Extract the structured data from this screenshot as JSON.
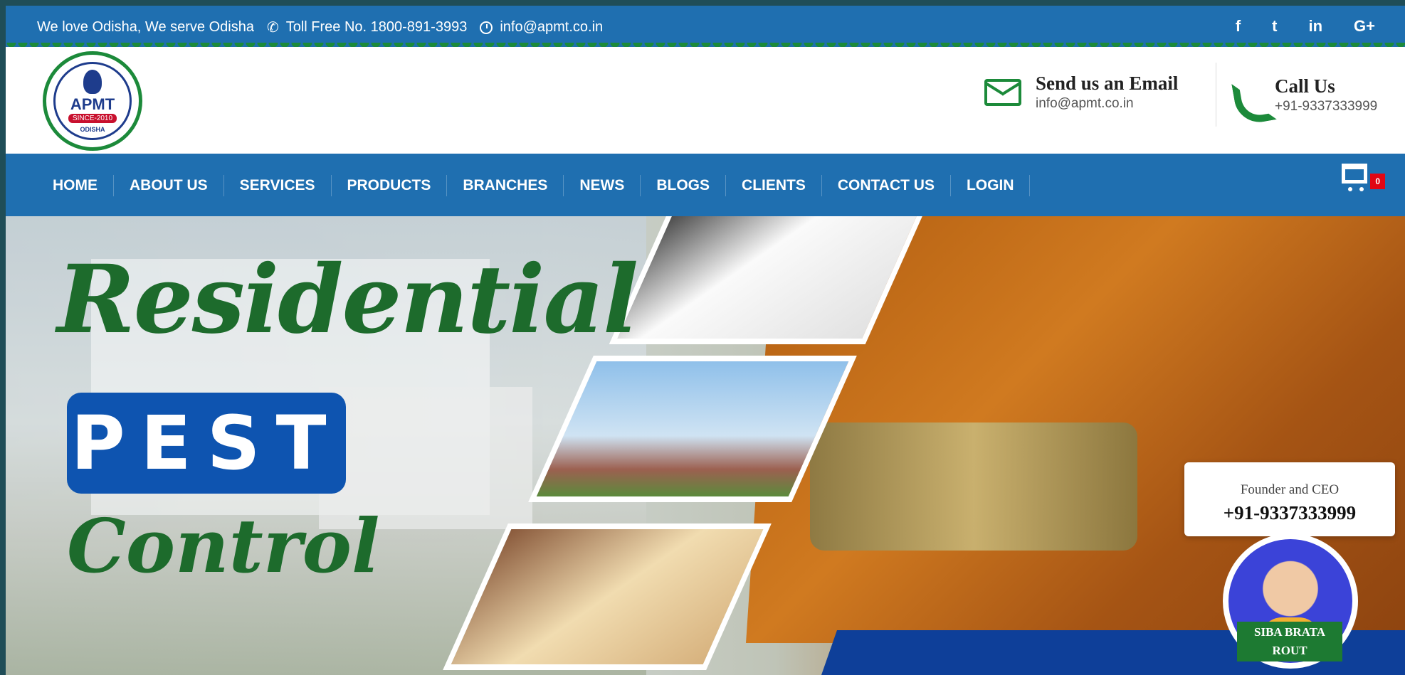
{
  "topbar": {
    "tagline": "We love Odisha, We serve Odisha",
    "tollfree": "Toll Free No. 1800-891-3993",
    "email": "info@apmt.co.in",
    "social": [
      "f",
      "t",
      "in",
      "G+"
    ]
  },
  "header": {
    "logo": {
      "abbr": "APMT",
      "since": "SINCE-2010",
      "place": "ODISHA"
    },
    "email_box": {
      "title": "Send us an Email",
      "value": "info@apmt.co.in"
    },
    "call_box": {
      "title": "Call Us",
      "value": "+91-9337333999"
    }
  },
  "nav": {
    "items": [
      "HOME",
      "ABOUT US",
      "SERVICES",
      "PRODUCTS",
      "BRANCHES",
      "NEWS",
      "BLOGS",
      "CLIENTS",
      "CONTACT US",
      "LOGIN"
    ],
    "cart_count": "0"
  },
  "hero": {
    "headline": "Residential",
    "badge": "PEST",
    "subline": "Control"
  },
  "ceo": {
    "role": "Founder and CEO",
    "phone": "+91-9337333999",
    "name_line1": "SIBA BRATA",
    "name_line2": "ROUT"
  },
  "colors": {
    "primary_blue": "#1f6fb0",
    "green": "#1c8a3a",
    "badge_red": "#e10613"
  }
}
